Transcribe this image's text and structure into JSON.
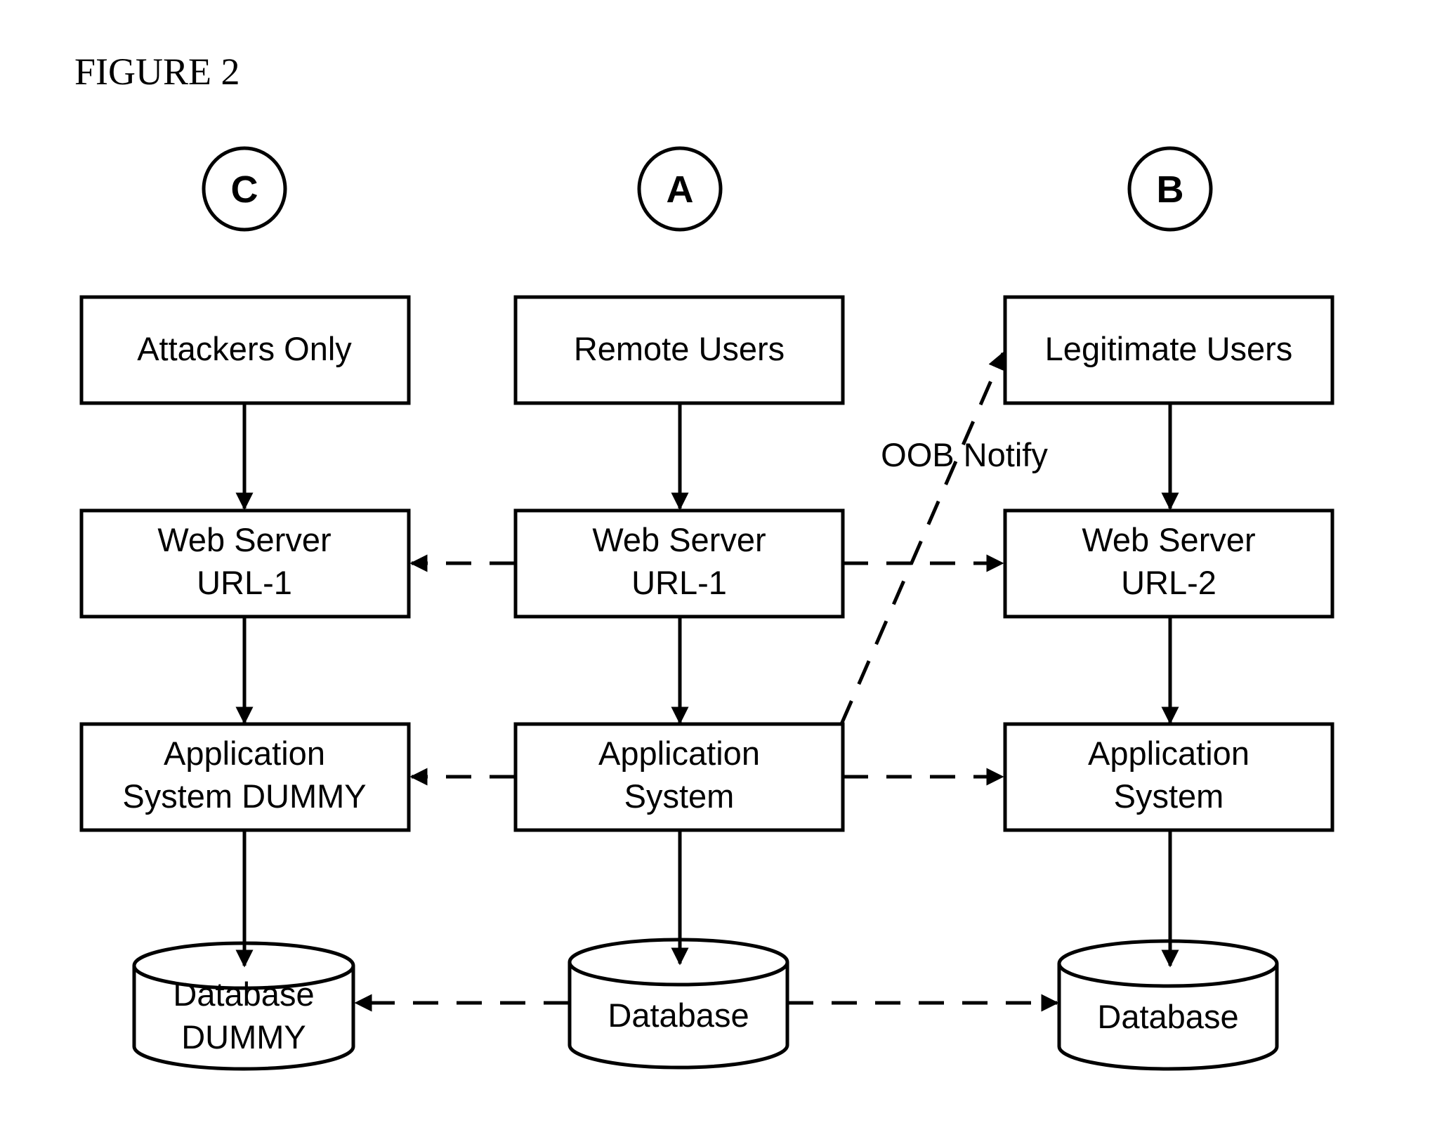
{
  "figure": {
    "title": "FIGURE 2",
    "columns": [
      {
        "id": "C",
        "circle_label": "C",
        "users": "Attackers Only",
        "web_server": [
          "Web Server",
          "URL-1"
        ],
        "app_system": [
          "Application",
          "System DUMMY"
        ],
        "database": [
          "Database",
          "DUMMY"
        ]
      },
      {
        "id": "A",
        "circle_label": "A",
        "users": "Remote Users",
        "web_server": [
          "Web Server",
          "URL-1"
        ],
        "app_system": [
          "Application",
          "System"
        ],
        "database": [
          "Database"
        ]
      },
      {
        "id": "B",
        "circle_label": "B",
        "users": "Legitimate Users",
        "web_server": [
          "Web Server",
          "URL-2"
        ],
        "app_system": [
          "Application",
          "System"
        ],
        "database": [
          "Database"
        ]
      }
    ],
    "oob_label": "OOB Notify",
    "edges": [
      {
        "from": "C.users",
        "to": "C.web_server",
        "style": "solid"
      },
      {
        "from": "C.web_server",
        "to": "C.app_system",
        "style": "solid"
      },
      {
        "from": "C.app_system",
        "to": "C.database",
        "style": "solid"
      },
      {
        "from": "A.users",
        "to": "A.web_server",
        "style": "solid"
      },
      {
        "from": "A.web_server",
        "to": "A.app_system",
        "style": "solid"
      },
      {
        "from": "A.app_system",
        "to": "A.database",
        "style": "solid"
      },
      {
        "from": "B.users",
        "to": "B.web_server",
        "style": "solid"
      },
      {
        "from": "B.web_server",
        "to": "B.app_system",
        "style": "solid"
      },
      {
        "from": "B.app_system",
        "to": "B.database",
        "style": "solid"
      },
      {
        "from": "A.web_server",
        "to": "C.web_server",
        "style": "dashed"
      },
      {
        "from": "A.web_server",
        "to": "B.web_server",
        "style": "dashed"
      },
      {
        "from": "A.app_system",
        "to": "C.app_system",
        "style": "dashed"
      },
      {
        "from": "A.app_system",
        "to": "B.app_system",
        "style": "dashed"
      },
      {
        "from": "A.database",
        "to": "C.database",
        "style": "dashed"
      },
      {
        "from": "A.database",
        "to": "B.database",
        "style": "dashed"
      },
      {
        "from": "A.app_system",
        "to": "B.users",
        "style": "dashed",
        "label": "OOB Notify"
      }
    ]
  }
}
